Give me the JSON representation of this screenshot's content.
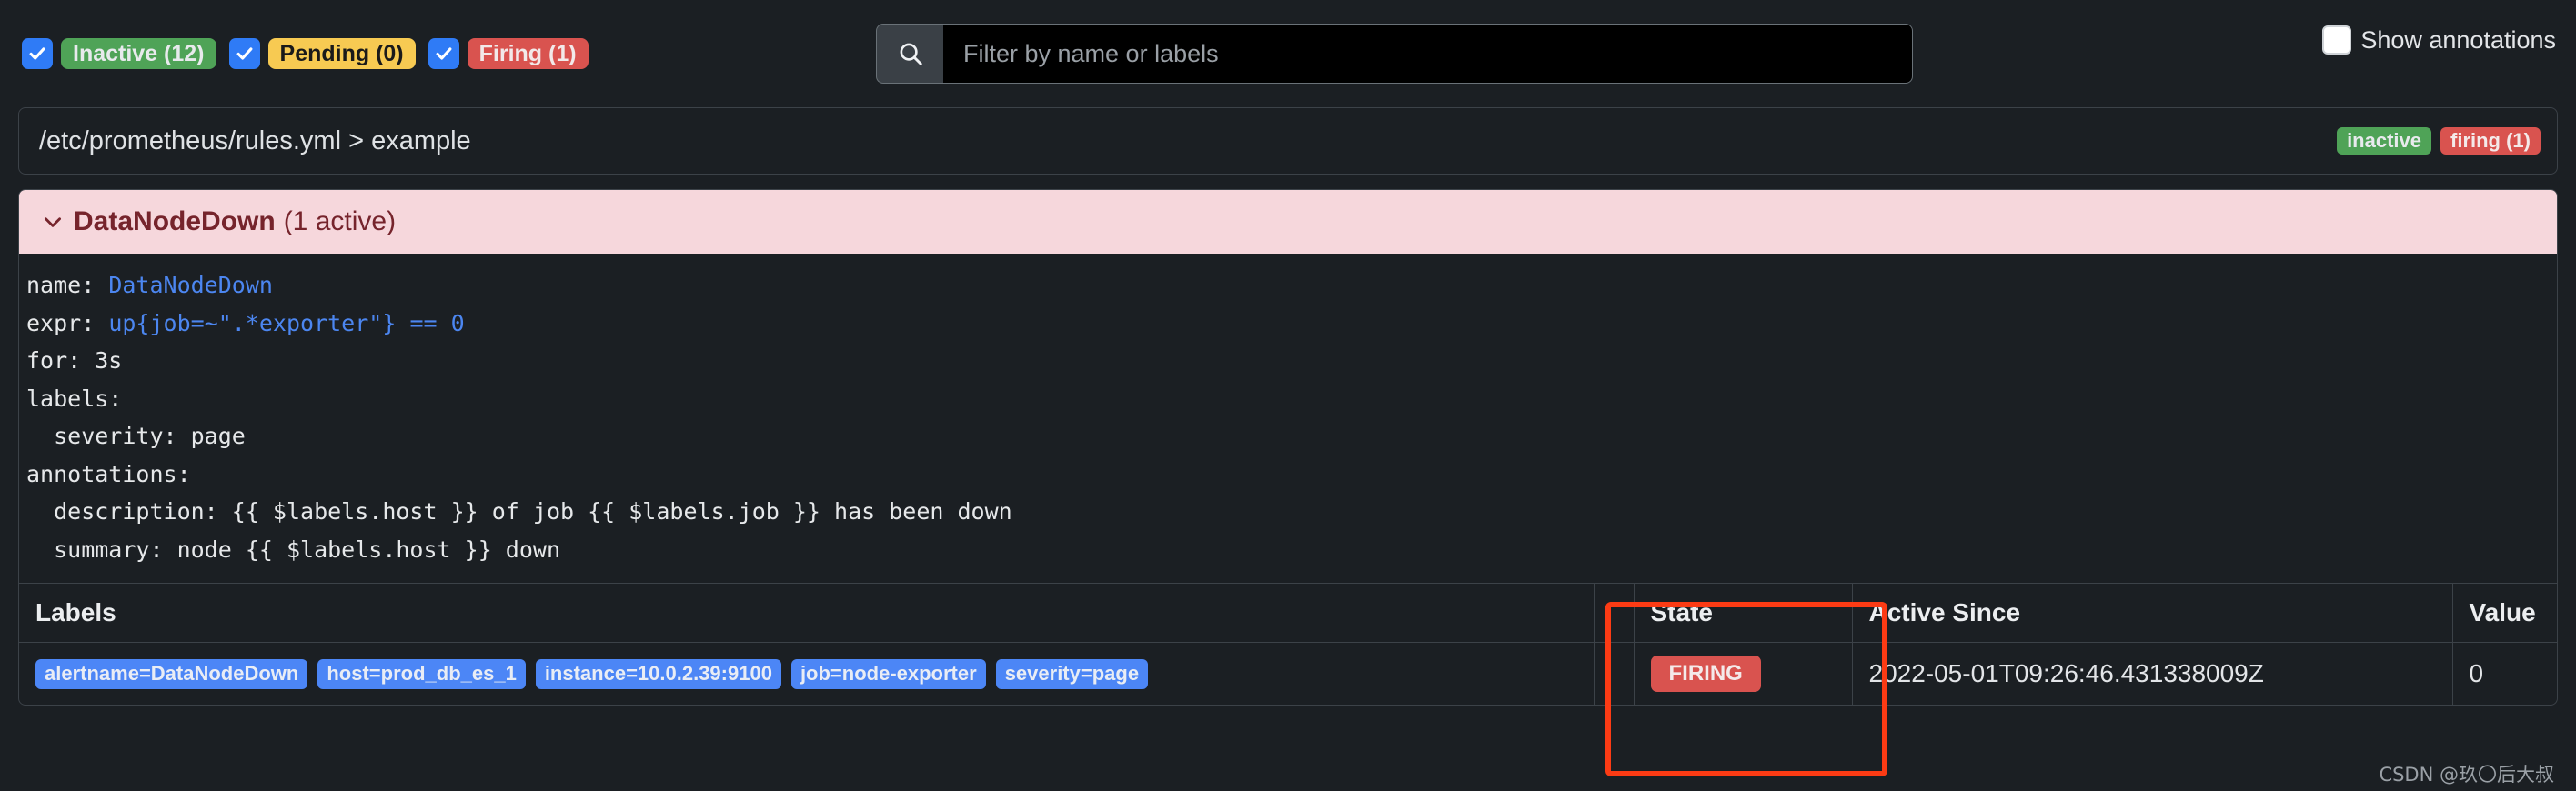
{
  "toolbar": {
    "filters": [
      {
        "label": "Inactive (12)",
        "checked": true,
        "style": "inactive",
        "name": "filter-inactive"
      },
      {
        "label": "Pending (0)",
        "checked": true,
        "style": "pending",
        "name": "filter-pending"
      },
      {
        "label": "Firing (1)",
        "checked": true,
        "style": "firing",
        "name": "filter-firing"
      }
    ],
    "search": {
      "placeholder": "Filter by name or labels",
      "value": "",
      "icon": "search-icon"
    },
    "show_annotations": {
      "label": "Show annotations",
      "checked": false
    }
  },
  "breadcrumb": {
    "text": "/etc/prometheus/rules.yml > example",
    "badges": [
      {
        "label": "inactive",
        "color": "#4fa357"
      },
      {
        "label": "firing (1)",
        "color": "#d9534f"
      }
    ]
  },
  "alert": {
    "chevron": "chevron-down-icon",
    "name": "DataNodeDown",
    "count": "(1 active)",
    "rule_yaml": [
      {
        "key": "name: ",
        "value": "DataNodeDown",
        "indent": 0
      },
      {
        "key": "expr: ",
        "value": "up{job=~\".*exporter\"} == 0",
        "indent": 0
      },
      {
        "key": "for: 3s",
        "value": "",
        "indent": 0
      },
      {
        "key": "labels:",
        "value": "",
        "indent": 0
      },
      {
        "key": "  severity: page",
        "value": "",
        "indent": 0
      },
      {
        "key": "annotations:",
        "value": "",
        "indent": 0
      },
      {
        "key": "  description: {{ $labels.host }} of job {{ $labels.job }} has been down",
        "value": "",
        "indent": 0
      },
      {
        "key": "  summary: node {{ $labels.host }} down",
        "value": "",
        "indent": 0
      }
    ]
  },
  "table": {
    "headers": {
      "labels": "Labels",
      "spacer": "",
      "state": "State",
      "active_since": "Active Since",
      "value": "Value"
    },
    "rows": [
      {
        "labels": [
          "alertname=DataNodeDown",
          "host=prod_db_es_1",
          "instance=10.0.2.39:9100",
          "job=node-exporter",
          "severity=page"
        ],
        "state": "FIRING",
        "active_since": "2022-05-01T09:26:46.431338009Z",
        "value": "0"
      }
    ]
  },
  "watermark": "CSDN @玖〇后大叔",
  "colors": {
    "accent_blue": "#2f7bf6",
    "green": "#4fa357",
    "yellow": "#f7ca52",
    "red": "#d9534f",
    "alert_header_bg": "#f6d7dc",
    "alert_header_fg": "#76242c",
    "annotation_box": "#fc3b14",
    "background": "#1b1f23"
  }
}
